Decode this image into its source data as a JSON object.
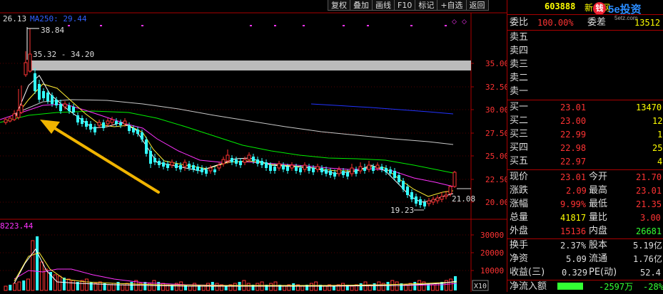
{
  "toolbar": {
    "buttons": [
      "复权",
      "叠加",
      "画线",
      "F10",
      "标记",
      "+自选",
      "返回"
    ]
  },
  "chart": {
    "ma_label": "26.13",
    "ma250_label": "MA250: 29.44",
    "price_axis": [
      "35.00",
      "32.50",
      "30.00",
      "27.50",
      "25.00",
      "22.50",
      "20.00"
    ],
    "vol_axis": [
      "30000",
      "20000",
      "10000"
    ],
    "vol_label": "8223.44",
    "high_label": "38.84",
    "range_label": "35.32 - 34.20",
    "low_label": "19.23",
    "last_label": "21.08",
    "scale_tag": "X10",
    "colors": {
      "up": "#ff3333",
      "down": "#33ffff",
      "ma5": "#ffffff",
      "ma10": "#ffff00",
      "ma20": "#ff00ff",
      "ma60": "#00ff00",
      "ma120": "#c8c8c8",
      "ma250": "#0000ff"
    }
  },
  "panel": {
    "code": "603888",
    "name": "新华网",
    "brand": "5e投资",
    "brand_icon": "钱",
    "brand_url": "5etz.com",
    "weibi_label": "委比",
    "weibi_value": "100.00%",
    "weicha_label": "委差",
    "weicha_value": "13512",
    "sell_labels": [
      "卖五",
      "卖四",
      "卖三",
      "卖二",
      "卖一"
    ],
    "buy": [
      {
        "label": "买一",
        "price": "23.01",
        "vol": "13470"
      },
      {
        "label": "买二",
        "price": "23.00",
        "vol": "12"
      },
      {
        "label": "买三",
        "price": "22.99",
        "vol": "1"
      },
      {
        "label": "买四",
        "price": "22.98",
        "vol": "25"
      },
      {
        "label": "买五",
        "price": "22.97",
        "vol": "4"
      }
    ],
    "stats": [
      {
        "l1": "现价",
        "v1": "23.01",
        "l2": "今开",
        "v2": "21.70"
      },
      {
        "l1": "涨跌",
        "v1": "2.09",
        "l2": "最高",
        "v2": "23.01"
      },
      {
        "l1": "涨幅",
        "v1": "9.99%",
        "l2": "最低",
        "v2": "21.35"
      },
      {
        "l1": "总量",
        "v1": "41817",
        "l2": "量比",
        "v2": "3.00"
      },
      {
        "l1": "外盘",
        "v1": "15136",
        "l2": "内盘",
        "v2": "26681"
      }
    ],
    "fundamentals": [
      {
        "l1": "换手",
        "v1": "2.37%",
        "l2": "股本",
        "v2": "5.19亿"
      },
      {
        "l1": "净资",
        "v1": "5.09",
        "l2": "流通",
        "v2": "1.76亿"
      },
      {
        "l1": "收益(三)",
        "v1": "0.329",
        "l2": "PE(动)",
        "v2": "52.4"
      }
    ],
    "netflow_label": "净流入额",
    "netflow_value": "-2597万",
    "netflow_pct": "-28%"
  }
}
